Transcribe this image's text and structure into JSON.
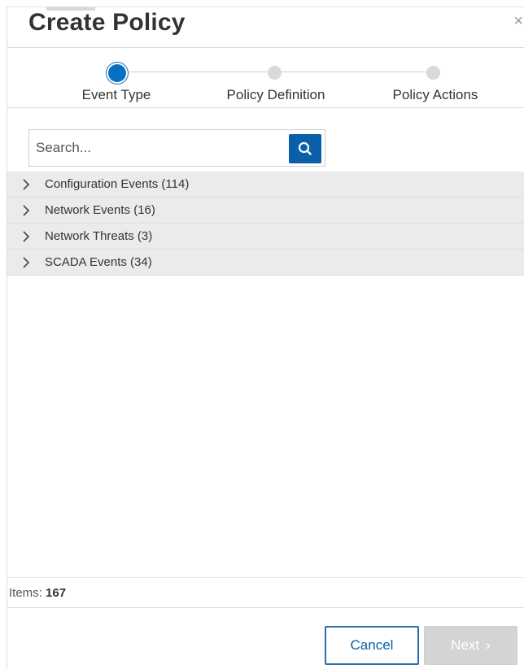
{
  "dialog": {
    "title": "Create Policy",
    "close_icon": "close-icon"
  },
  "stepper": {
    "steps": [
      {
        "label": "Event Type",
        "state": "active"
      },
      {
        "label": "Policy Definition",
        "state": "inactive"
      },
      {
        "label": "Policy Actions",
        "state": "inactive"
      }
    ]
  },
  "search": {
    "placeholder": "Search...",
    "value": "",
    "button_icon": "search-icon"
  },
  "event_groups": [
    {
      "label": "Configuration Events (114)",
      "icon": "chevron-right-icon"
    },
    {
      "label": "Network Events (16)",
      "icon": "chevron-right-icon"
    },
    {
      "label": "Network Threats (3)",
      "icon": "chevron-right-icon"
    },
    {
      "label": "SCADA Events (34)",
      "icon": "chevron-right-icon"
    }
  ],
  "footer": {
    "items_label": "Items:",
    "items_count": "167",
    "cancel_label": "Cancel",
    "next_label": "Next"
  },
  "colors": {
    "accent": "#0a5fa8",
    "active_step": "#0a6fc2",
    "inactive_step": "#d9d9d9",
    "row_bg": "#ebebeb",
    "disabled_btn": "#d4d4d4"
  }
}
